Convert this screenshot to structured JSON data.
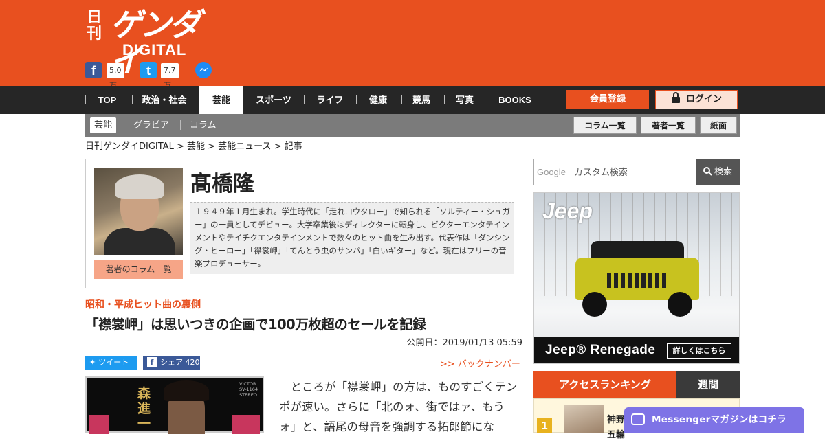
{
  "brand": {
    "kanji": "日刊",
    "name": "ゲンダイ",
    "sub": "DIGITAL"
  },
  "social": {
    "facebook_icon": "f",
    "facebook_count": "5.0万",
    "twitter_icon": "t",
    "twitter_count": "7.7万"
  },
  "nav": {
    "items": [
      "TOP",
      "政治・社会",
      "芸能",
      "スポーツ",
      "ライフ",
      "健康",
      "競馬",
      "写真",
      "BOOKS"
    ],
    "register": "会員登録",
    "login": "ログイン"
  },
  "subnav": {
    "items": [
      "芸能",
      "グラビア",
      "コラム"
    ],
    "buttons": [
      "コラム一覧",
      "著者一覧",
      "紙面"
    ]
  },
  "breadcrumb": "日刊ゲンダイDIGITAL > 芸能 > 芸能ニュース > 記事",
  "author": {
    "name": "髙橋隆",
    "column_button": "著者のコラム一覧",
    "bio": "１９４９年１月生まれ。学生時代に「走れコウタロー」で知られる「ソルティー・シュガー」の一員としてデビュー。大学卒業後はディレクターに転身し、ビクターエンタテインメントやテイチクエンタテインメントで数々のヒット曲を生み出す。代表作は「ダンシング・ヒーロー」「襟裳岬」「てんとう虫のサンバ」「白いギター」など。現在はフリーの音楽プロデューサー。"
  },
  "article": {
    "series": "昭和・平成ヒット曲の裏側",
    "title": "「襟裳岬」は思いつきの企画で100万枚超のセールを記録",
    "published": "公開日：2019/01/13 05:59",
    "tweet": "ツイート",
    "share": "シェア 420",
    "backnumber": ">> バックナンバー",
    "body": "ところが「襟裳岬」の方は、ものすごくテンポが速い。さらに「北のォ、街ではァ、もうォ」と、語尾の母音を強調する拓郎節にな",
    "record_title": "森進一",
    "record_label": "VICTOR SV-1164 STEREO"
  },
  "sidebar": {
    "search_google": "Google",
    "search_placeholder": "カスタム検索",
    "search_button": "検索",
    "ad_brand": "Jeep",
    "ad_model": "Jeep® Renegade",
    "ad_cta": "詳しくはこちら",
    "ranking_title": "アクセスランキング",
    "ranking_period": "週間",
    "rank1_num": "1",
    "rank1_text": "神野\n五輪"
  },
  "messenger": "Messengerマガジンはコチラ",
  "colors": {
    "brand": "#e8501f",
    "nav": "#262626",
    "subnav": "#7b7b7b",
    "messenger": "#7e73e6"
  }
}
